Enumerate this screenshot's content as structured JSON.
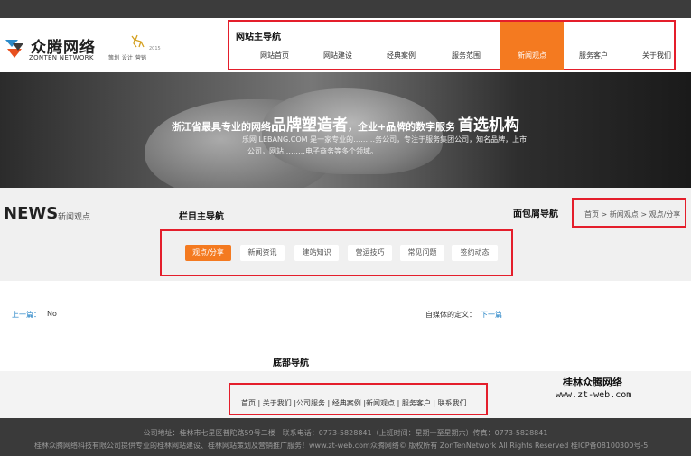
{
  "header": {
    "logo_cn": "众腾网络",
    "logo_en": "ZONTEN NETWORK",
    "slogan": "策划 设计 营销",
    "slogan_year": "2015"
  },
  "nav": {
    "annotation": "网站主导航",
    "items": [
      "网站首页",
      "网站建设",
      "经典案例",
      "服务范围",
      "新闻观点",
      "服务客户",
      "关于我们"
    ],
    "active_index": 4
  },
  "banner": {
    "headline_a": "浙江省最具专业的网络",
    "headline_b": "品牌塑造者",
    "headline_c": "，企业+品牌的数字服务",
    "headline_d": "首选机构",
    "sub_line1": "乐网 LEBANG.COM 是一家专业的………务公司，专注于服务集团公司，知名品牌，上市",
    "sub_line2": "公司，网站………电子商务等多个领域。"
  },
  "section": {
    "title": "NEWS",
    "subtitle": "新闻观点",
    "column_annotation": "栏目主导航",
    "breadcrumb_annotation": "面包屑导航",
    "breadcrumb": "首页 > 新闻观点 > 观点/分享"
  },
  "tabs": {
    "items": [
      "观点/分享",
      "新闻资讯",
      "建站知识",
      "营运技巧",
      "常见问题",
      "签约动态"
    ],
    "active_index": 0
  },
  "pager": {
    "prev_label": "上一篇：",
    "prev_value": "No",
    "next_prefix": "自媒体的定义：",
    "next_label": "下一篇"
  },
  "footer": {
    "annotation": "底部导航",
    "links": "首页 | 关于我们 |公司服务 | 经典案例 |新闻观点 | 服务客户 | 联系我们",
    "brand_cn": "桂林众腾网络",
    "brand_url": "www.zt-web.com",
    "line1": "公司地址：桂林市七星区普陀路59号二楼　联系电话：0773-5828841（上班时间：星期一至星期六）传真：0773-5828841",
    "line2": "桂林众腾网络科技有限公司提供专业的桂林网站建设、桂林网站策划及营销推广服务！www.zt-web.com众腾网络© 版权所有 ZonTenNetwork All Rights Reserved  桂ICP备08100300号-5"
  },
  "colors": {
    "accent": "#f47a20",
    "annotation_border": "#e41e2b",
    "link": "#1e7fc4"
  }
}
